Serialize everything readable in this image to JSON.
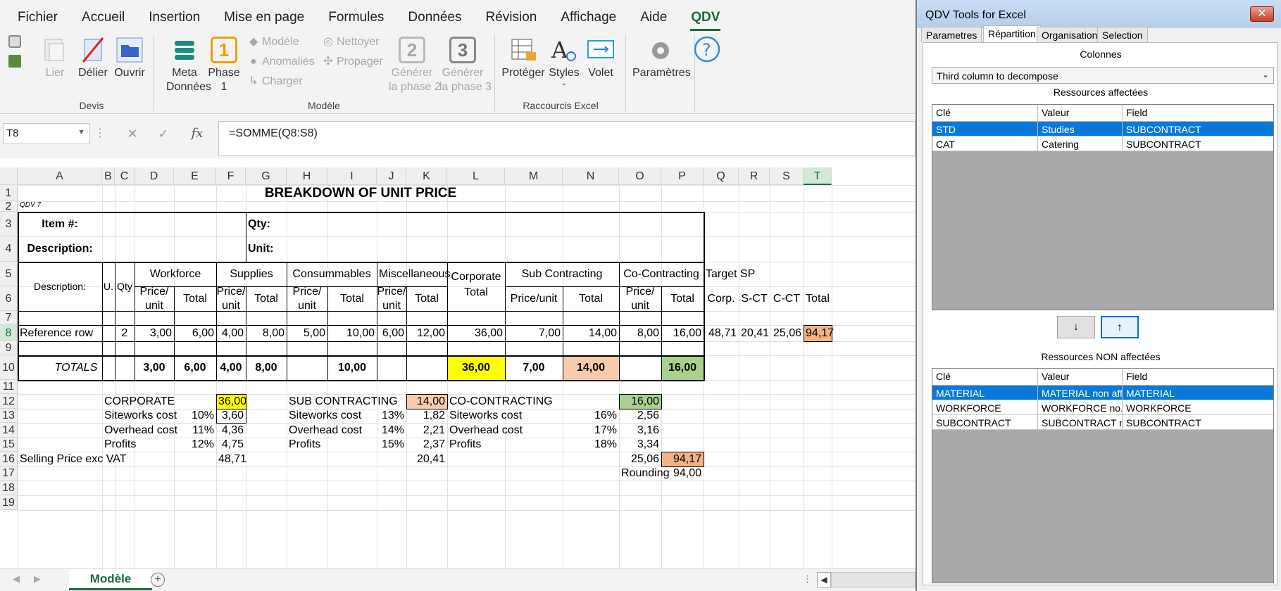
{
  "menu": [
    "Fichier",
    "Accueil",
    "Insertion",
    "Mise en page",
    "Formules",
    "Données",
    "Révision",
    "Affichage",
    "Aide",
    "QDV"
  ],
  "ribbon": {
    "devis": {
      "label": "Devis",
      "lier": "Lier",
      "delier": "Délier",
      "ouvrir": "Ouvrir"
    },
    "modele": {
      "label": "Modèle",
      "meta1": "Meta",
      "meta2": "Données",
      "phase1a": "Phase",
      "phase1b": "1",
      "phase1num": "1",
      "modele": "Modèle",
      "anomalies": "Anomalies",
      "charger": "Charger",
      "nettoyer": "Nettoyer",
      "propager": "Propager",
      "gen2a": "Générer",
      "gen2b": "la phase 2",
      "gen2num": "2",
      "gen3a": "Générer",
      "gen3b": "la phase 3",
      "gen3num": "3"
    },
    "raccourcis": {
      "label": "Raccourcis Excel",
      "proteger": "Protéger",
      "styles": "Styles",
      "volet": "Volet"
    },
    "parametres": "Paramètres"
  },
  "formula": {
    "namebox": "T8",
    "fx": "fx",
    "value": "=SOMME(Q8:S8)"
  },
  "columns": [
    "A",
    "B",
    "C",
    "D",
    "E",
    "F",
    "G",
    "H",
    "I",
    "J",
    "K",
    "L",
    "M",
    "N",
    "O",
    "P",
    "Q",
    "R",
    "S",
    "T"
  ],
  "rows": [
    "1",
    "2",
    "3",
    "4",
    "5",
    "6",
    "7",
    "8",
    "9",
    "10",
    "11",
    "12",
    "13",
    "14",
    "15",
    "16",
    "17",
    "18",
    "19"
  ],
  "sheet": {
    "title": "BREAKDOWN OF UNIT PRICE",
    "qdv": "QDV 7",
    "item": "Item #:",
    "qty": "Qty:",
    "description": "Description:",
    "unit": "Unit:",
    "h_desc": "Description:",
    "h_u": "U.",
    "h_qty": "Qty",
    "workforce": "Workforce",
    "supplies": "Supplies",
    "consummables": "Consummables",
    "misc": "Miscellaneous",
    "corp1": "Corporate",
    "corp2": "Total",
    "subcon": "Sub Contracting",
    "cocon": "Co-Contracting",
    "target": "Target SP",
    "pu1": "Price/",
    "pu2": "unit",
    "total": "Total",
    "puu": "Price/unit",
    "corp": "Corp.",
    "sct": "S-CT",
    "cct": "C-CT",
    "r8": {
      "a": "Reference row",
      "c": "2",
      "d": "3,00",
      "e": "6,00",
      "f": "4,00",
      "g": "8,00",
      "h": "5,00",
      "i": "10,00",
      "j": "6,00",
      "k": "12,00",
      "l": "36,00",
      "m": "7,00",
      "n": "14,00",
      "o": "8,00",
      "p": "16,00",
      "q": "48,71",
      "r": "20,41",
      "s": "25,06",
      "t": "94,17"
    },
    "r10": {
      "label": "TOTALS",
      "d": "3,00",
      "e": "6,00",
      "f": "4,00",
      "g": "8,00",
      "i": "10,00",
      "l": "36,00",
      "m": "7,00",
      "n": "14,00",
      "p": "16,00"
    },
    "corporate": "CORPORATE",
    "corporate_v": "36,00",
    "subcontracting": "SUB CONTRACTING",
    "subcontracting_v": "14,00",
    "cocontracting": "CO-CONTRACTING",
    "cocontracting_v": "16,00",
    "siteworks": "Siteworks cost",
    "overhead": "Overhead cost",
    "profits": "Profits",
    "c_site_p": "10%",
    "c_site_v": "3,60",
    "c_over_p": "11%",
    "c_over_v": "4,36",
    "c_prof_p": "12%",
    "c_prof_v": "4,75",
    "s_site_p": "13%",
    "s_site_v": "1,82",
    "s_over_p": "14%",
    "s_over_v": "2,21",
    "s_prof_p": "15%",
    "s_prof_v": "2,37",
    "o_site_p": "16%",
    "o_site_v": "2,56",
    "o_over_p": "17%",
    "o_over_v": "3,16",
    "o_prof_p": "18%",
    "o_prof_v": "3,34",
    "selling": "Selling Price  exc VAT",
    "sp_c": "48,71",
    "sp_s": "20,41",
    "sp_o": "25,06",
    "sp_t": "94,17",
    "rounding": "Rounding",
    "rounding_v": "94,00"
  },
  "sheet_tab": "Modèle",
  "panel": {
    "title": "QDV Tools for Excel",
    "tabs": [
      "Parametres",
      "Répartition",
      "Organisation",
      "Selection"
    ],
    "colonnes": "Colonnes",
    "select": "Third column to decompose",
    "affectees": "Ressources affectées",
    "non_affectees": "Ressources NON affectées",
    "headers": [
      "Clé",
      "Valeur",
      "Field"
    ],
    "list1": [
      [
        "STD",
        "Studies",
        "SUBCONTRACT"
      ],
      [
        "CAT",
        "Catering",
        "SUBCONTRACT"
      ]
    ],
    "list2": [
      [
        "MATERIAL",
        "MATERIAL non aff...",
        "MATERIAL"
      ],
      [
        "WORKFORCE",
        "WORKFORCE no...",
        "WORKFORCE"
      ],
      [
        "SUBCONTRACT",
        "SUBCONTRACT n...",
        "SUBCONTRACT"
      ]
    ],
    "down": "↓",
    "up": "↑"
  },
  "colors": {
    "yellow": "#ffff00",
    "salmon": "#f8cbad",
    "green": "#a9d08e",
    "orange": "#f4b183",
    "accent": "#1b6a3c",
    "select": "#0a78d7"
  }
}
